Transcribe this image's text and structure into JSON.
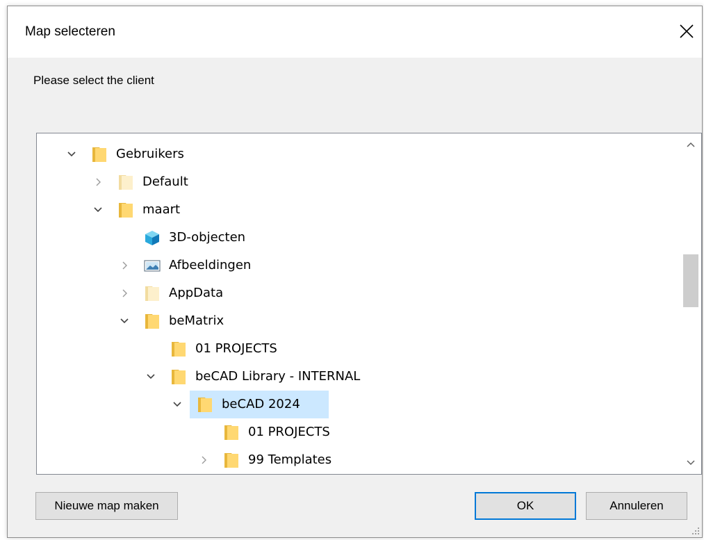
{
  "window": {
    "title": "Map selecteren",
    "close_icon": "close-icon"
  },
  "prompt": "Please select the client",
  "tree": {
    "rows": [
      {
        "label": "Gebruikers",
        "depth": 0,
        "expander": "expanded",
        "icon": "folder-icon"
      },
      {
        "label": "Default",
        "depth": 1,
        "expander": "collapsed",
        "icon": "folder-faded-icon"
      },
      {
        "label": "maart",
        "depth": 1,
        "expander": "expanded",
        "icon": "folder-icon"
      },
      {
        "label": "3D-objecten",
        "depth": 2,
        "expander": "none",
        "icon": "3d-objects-icon"
      },
      {
        "label": "Afbeeldingen",
        "depth": 2,
        "expander": "collapsed",
        "icon": "pictures-icon"
      },
      {
        "label": "AppData",
        "depth": 2,
        "expander": "collapsed",
        "icon": "folder-faded-icon"
      },
      {
        "label": "beMatrix",
        "depth": 2,
        "expander": "expanded",
        "icon": "folder-icon"
      },
      {
        "label": "01 PROJECTS",
        "depth": 3,
        "expander": "none",
        "icon": "folder-icon"
      },
      {
        "label": "beCAD Library - INTERNAL",
        "depth": 3,
        "expander": "expanded",
        "icon": "folder-icon"
      },
      {
        "label": "beCAD 2024",
        "depth": 4,
        "expander": "expanded",
        "icon": "folder-icon",
        "selected": true
      },
      {
        "label": "01 PROJECTS",
        "depth": 5,
        "expander": "none",
        "icon": "folder-icon"
      },
      {
        "label": "99 Templates",
        "depth": 5,
        "expander": "collapsed",
        "icon": "folder-icon"
      }
    ],
    "scroll_position": 0.45
  },
  "buttons": {
    "new_folder": "Nieuwe map maken",
    "ok": "OK",
    "cancel": "Annuleren"
  },
  "colors": {
    "selection": "#cce8ff",
    "folder_fill": "#ffd872",
    "folder_tab": "#e8b73c",
    "folder_faded": "#fdf0cc",
    "accent": "#0078d7"
  }
}
